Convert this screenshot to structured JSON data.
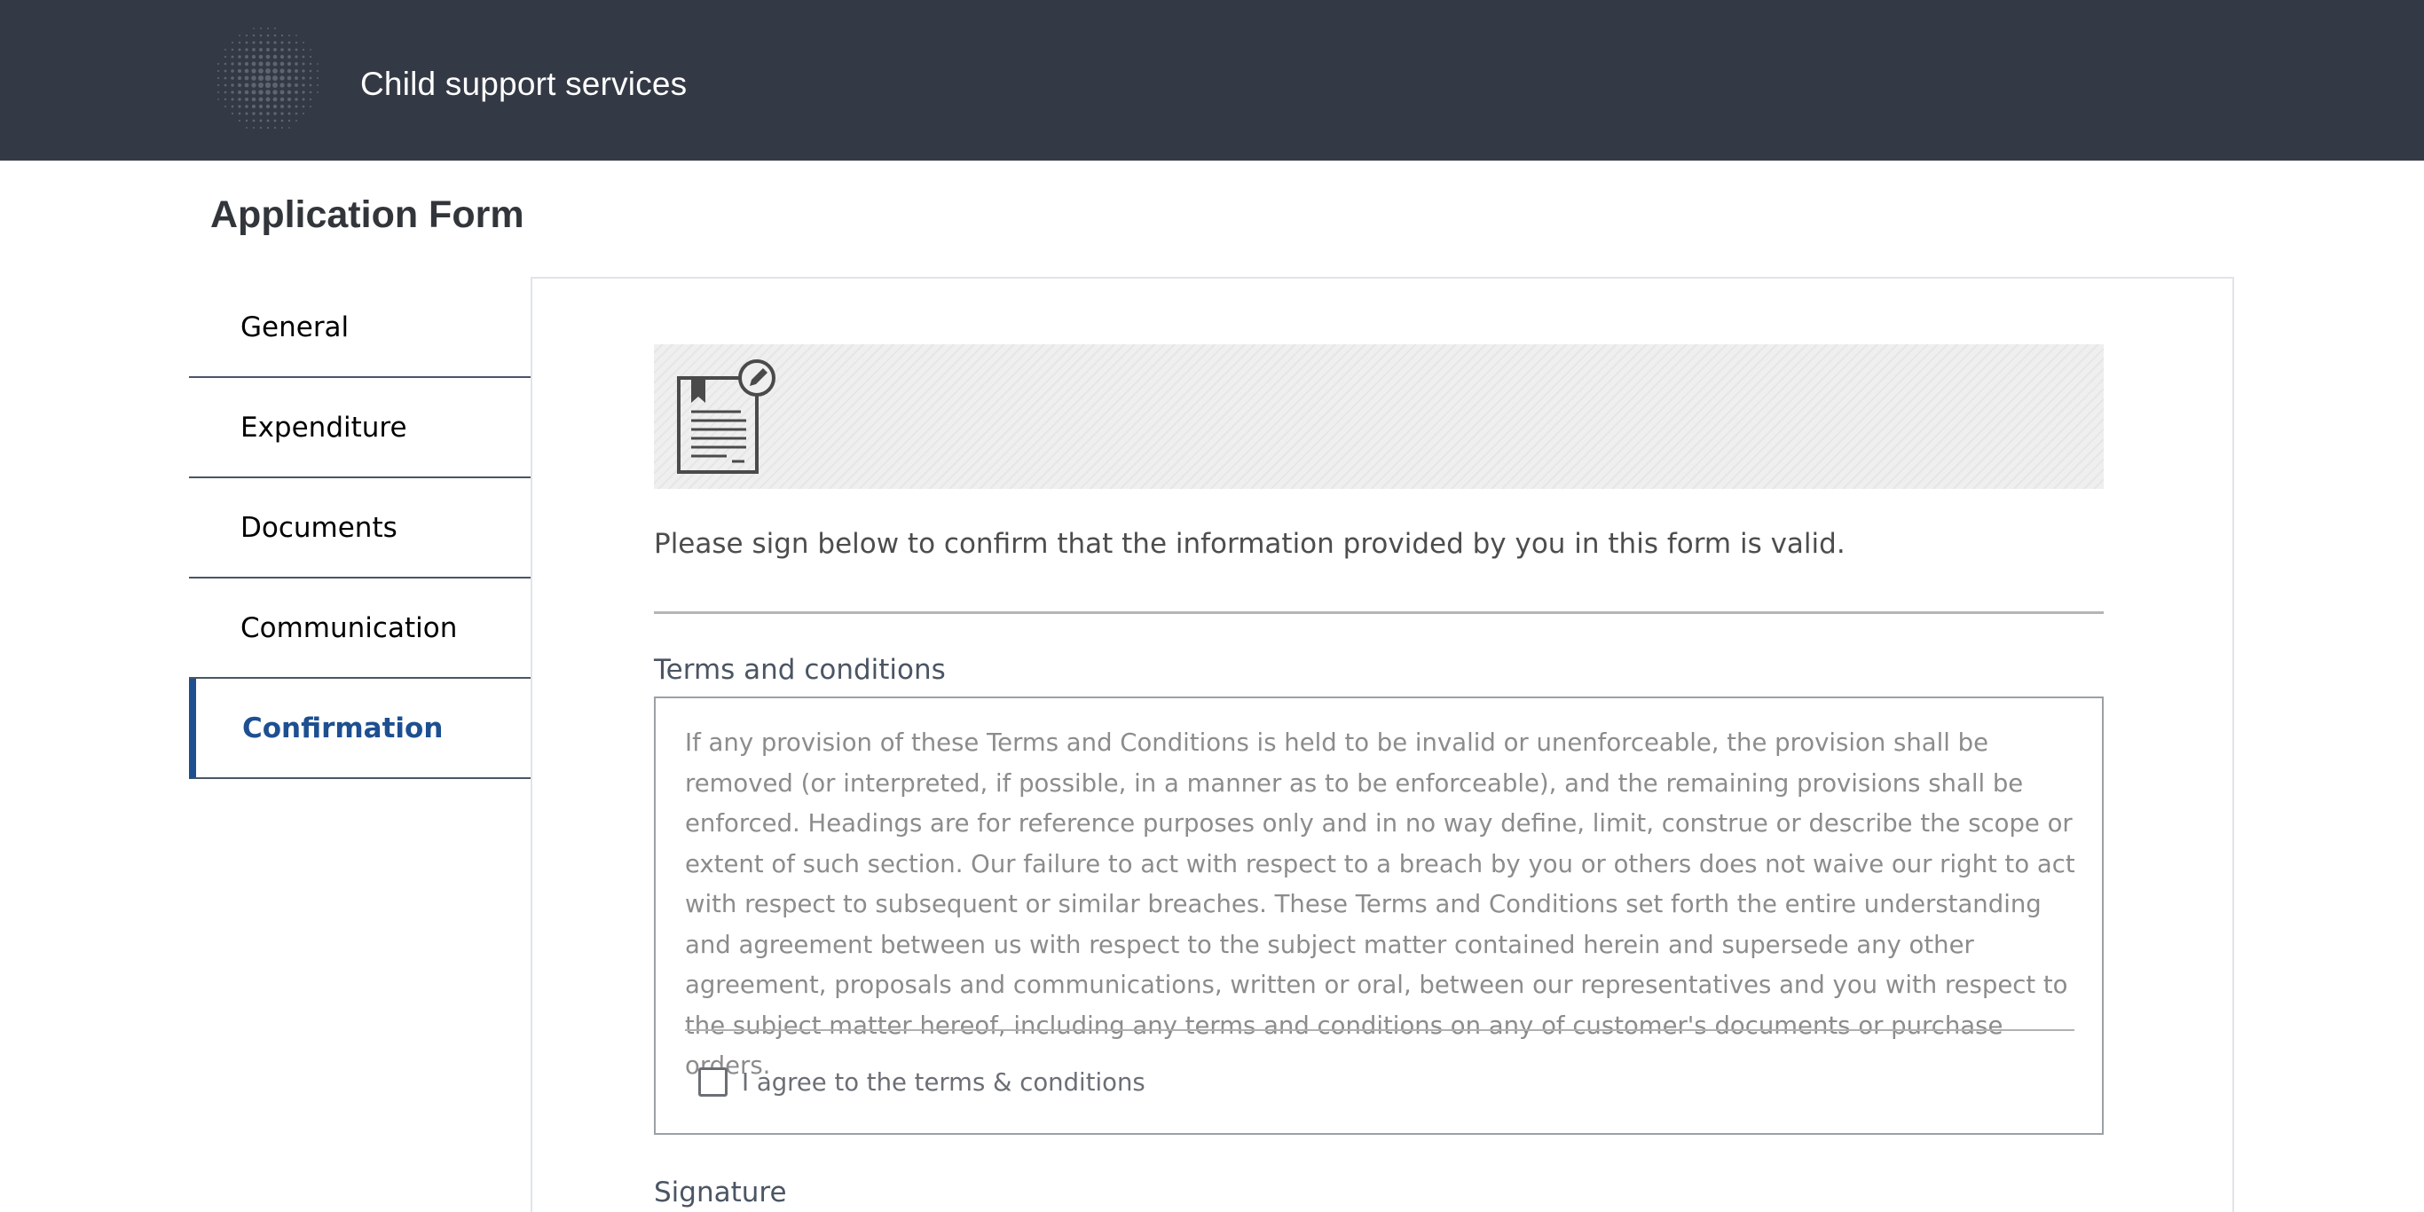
{
  "shell": {
    "title": "Child support services",
    "logo_icon": "dotted-sphere-logo",
    "background_color": "#343a45"
  },
  "page": {
    "title": "Application Form"
  },
  "nav": {
    "items": [
      {
        "label": "General",
        "selected": false
      },
      {
        "label": "Expenditure",
        "selected": false
      },
      {
        "label": "Documents",
        "selected": false
      },
      {
        "label": "Communication",
        "selected": false
      },
      {
        "label": "Confirmation",
        "selected": true
      }
    ],
    "accent_color": "#1d4f91"
  },
  "confirmation": {
    "illustration_icon": "signed-document-icon",
    "intro": "Please sign below to confirm that the information provided by you in this form is valid.",
    "terms_label": "Terms and conditions",
    "terms_text": "If any provision of these Terms and Conditions is held to be invalid or unenforceable, the provision shall be removed (or interpreted, if possible, in a manner as to be enforceable), and the remaining provisions shall be enforced. Headings are for reference purposes only and in no way define, limit, construe or describe the scope or extent of such section. Our failure to act with respect to a breach by you or others does not waive our right to act with respect to subsequent or similar breaches. These Terms and Conditions set forth the entire understanding and agreement between us with respect to the subject matter contained herein and supersede any other agreement, proposals and communications, written or oral, between our representatives and you with respect to the subject matter hereof, including any terms and conditions on any of customer's documents or purchase orders.",
    "agree_label": "I agree to the terms & conditions",
    "agree_checked": false,
    "signature_label": "Signature",
    "signature_icon": "pen-icon"
  }
}
